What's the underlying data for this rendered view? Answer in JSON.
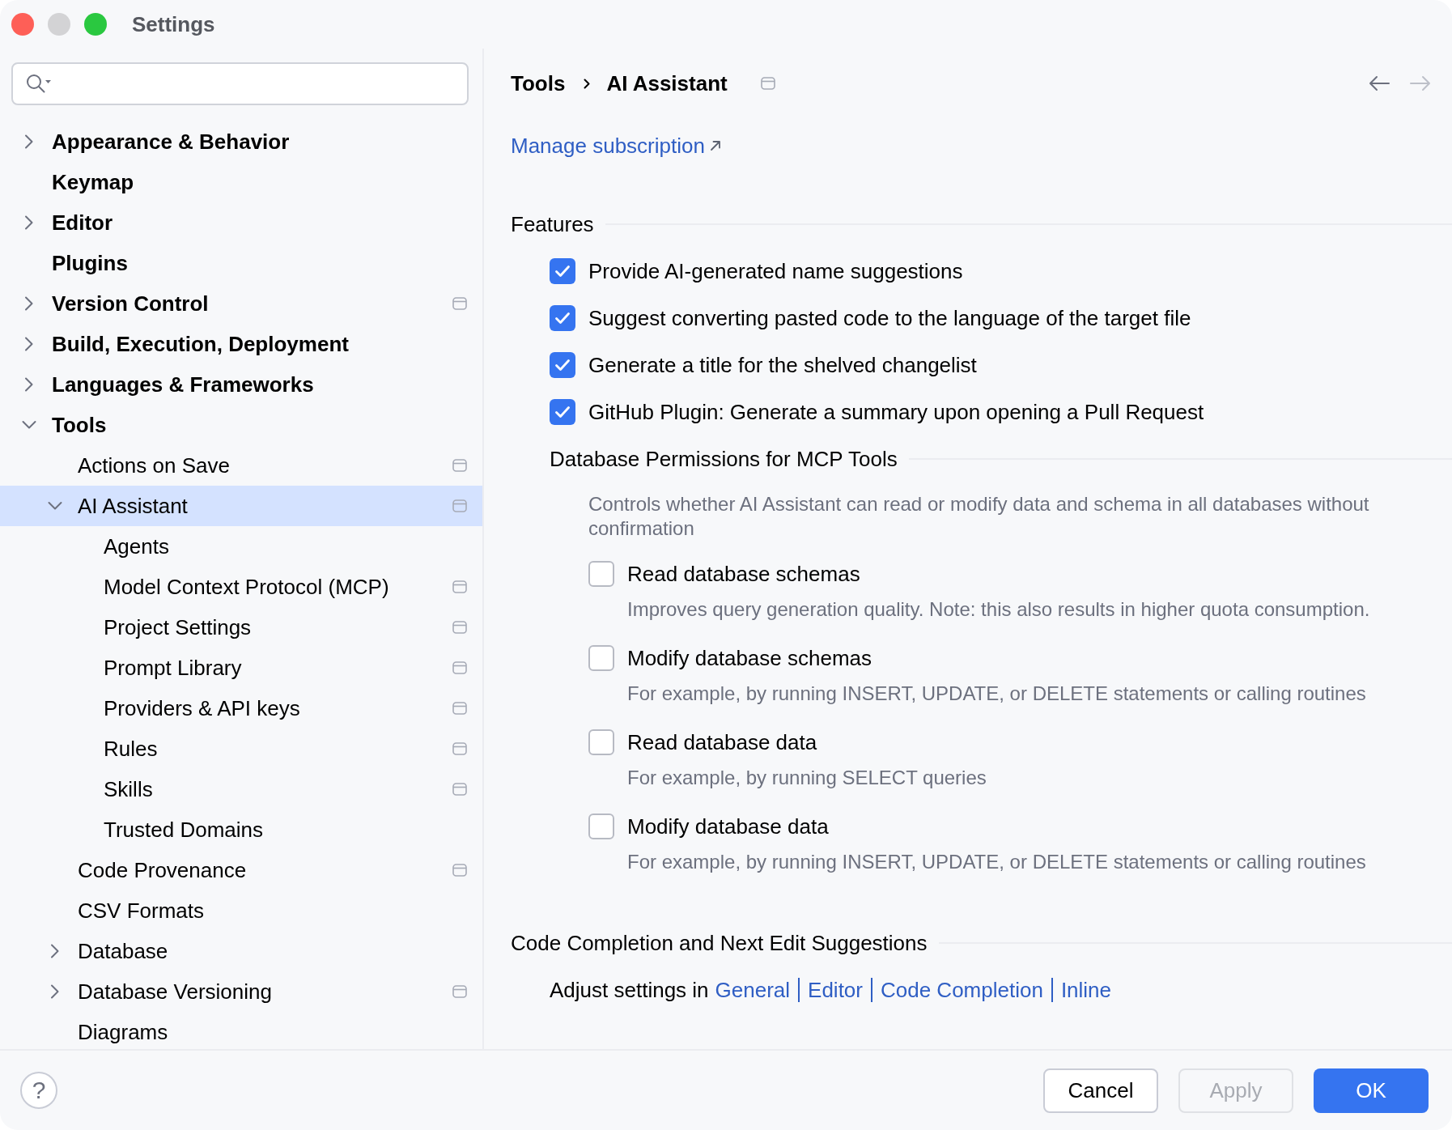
{
  "window": {
    "title": "Settings",
    "controls": [
      {
        "kind": "close",
        "disabled": false
      },
      {
        "kind": "minimize",
        "disabled": true
      },
      {
        "kind": "zoom",
        "disabled": false
      }
    ]
  },
  "sidebar": {
    "items": [
      {
        "label": "Appearance & Behavior",
        "kind": "group",
        "expanded": false,
        "scope_icon": false,
        "selected": false
      },
      {
        "label": "Keymap",
        "kind": "page",
        "scope_icon": false,
        "selected": false
      },
      {
        "label": "Editor",
        "kind": "group",
        "expanded": false,
        "scope_icon": false,
        "selected": false
      },
      {
        "label": "Plugins",
        "kind": "page",
        "scope_icon": false,
        "selected": false
      },
      {
        "label": "Version Control",
        "kind": "group",
        "expanded": false,
        "scope_icon": true,
        "selected": false
      },
      {
        "label": "Build, Execution, Deployment",
        "kind": "group",
        "expanded": false,
        "scope_icon": false,
        "selected": false
      },
      {
        "label": "Languages & Frameworks",
        "kind": "group",
        "expanded": false,
        "scope_icon": false,
        "selected": false
      },
      {
        "label": "Tools",
        "kind": "group",
        "expanded": true,
        "scope_icon": false,
        "selected": false,
        "children": [
          {
            "label": "Actions on Save",
            "kind": "page",
            "scope_icon": true,
            "selected": false
          },
          {
            "label": "AI Assistant",
            "kind": "group",
            "expanded": true,
            "scope_icon": true,
            "selected": true,
            "children": [
              {
                "label": "Agents",
                "kind": "page",
                "scope_icon": false,
                "selected": false
              },
              {
                "label": "Model Context Protocol (MCP)",
                "kind": "page",
                "scope_icon": true,
                "selected": false
              },
              {
                "label": "Project Settings",
                "kind": "page",
                "scope_icon": true,
                "selected": false
              },
              {
                "label": "Prompt Library",
                "kind": "page",
                "scope_icon": true,
                "selected": false
              },
              {
                "label": "Providers & API keys",
                "kind": "page",
                "scope_icon": true,
                "selected": false
              },
              {
                "label": "Rules",
                "kind": "page",
                "scope_icon": true,
                "selected": false
              },
              {
                "label": "Skills",
                "kind": "page",
                "scope_icon": true,
                "selected": false
              },
              {
                "label": "Trusted Domains",
                "kind": "page",
                "scope_icon": false,
                "selected": false
              }
            ]
          },
          {
            "label": "Code Provenance",
            "kind": "page",
            "scope_icon": true,
            "selected": false
          },
          {
            "label": "CSV Formats",
            "kind": "page",
            "scope_icon": false,
            "selected": false
          },
          {
            "label": "Database",
            "kind": "group",
            "expanded": false,
            "scope_icon": false,
            "selected": false
          },
          {
            "label": "Database Versioning",
            "kind": "group",
            "expanded": false,
            "scope_icon": true,
            "selected": false
          },
          {
            "label": "Diagrams",
            "kind": "page",
            "scope_icon": false,
            "selected": false
          }
        ]
      }
    ]
  },
  "header": {
    "breadcrumb": [
      "Tools",
      "AI Assistant"
    ],
    "scope_icon": true,
    "nav": [
      {
        "kind": "back",
        "disabled": false
      },
      {
        "kind": "forward",
        "disabled": true
      }
    ]
  },
  "subscription_link": {
    "label": "Manage subscription",
    "external": true
  },
  "features": {
    "title": "Features",
    "options": [
      {
        "label": "Provide AI-generated name suggestions",
        "checked": true
      },
      {
        "label": "Suggest converting pasted code to the language of the target file",
        "checked": true
      },
      {
        "label": "Generate a title for the shelved changelist",
        "checked": true
      },
      {
        "label": "GitHub Plugin: Generate a summary upon opening a Pull Request",
        "checked": true
      }
    ],
    "database_permissions": {
      "title": "Database Permissions for MCP Tools",
      "description": "Controls whether AI Assistant can read or modify data and schema in all databases without confirmation",
      "options": [
        {
          "label": "Read database schemas",
          "hint": "Improves query generation quality. Note: this also results in higher quota consumption.",
          "checked": false
        },
        {
          "label": "Modify database schemas",
          "hint": "For example, by running INSERT, UPDATE, or DELETE statements or calling routines",
          "checked": false
        },
        {
          "label": "Read database data",
          "hint": "For example, by running SELECT queries",
          "checked": false
        },
        {
          "label": "Modify database data",
          "hint": "For example, by running INSERT, UPDATE, or DELETE statements or calling routines",
          "checked": false
        }
      ]
    }
  },
  "code_completion": {
    "title": "Code Completion and Next Edit Suggestions",
    "text": "Adjust settings in",
    "links": [
      "General",
      "Editor",
      "Code Completion",
      "Inline"
    ]
  },
  "footer": {
    "help": "?",
    "buttons": [
      {
        "label": "Cancel",
        "kind": "secondary",
        "disabled": false
      },
      {
        "label": "Apply",
        "kind": "secondary",
        "disabled": true
      },
      {
        "label": "OK",
        "kind": "primary",
        "disabled": false
      }
    ]
  }
}
